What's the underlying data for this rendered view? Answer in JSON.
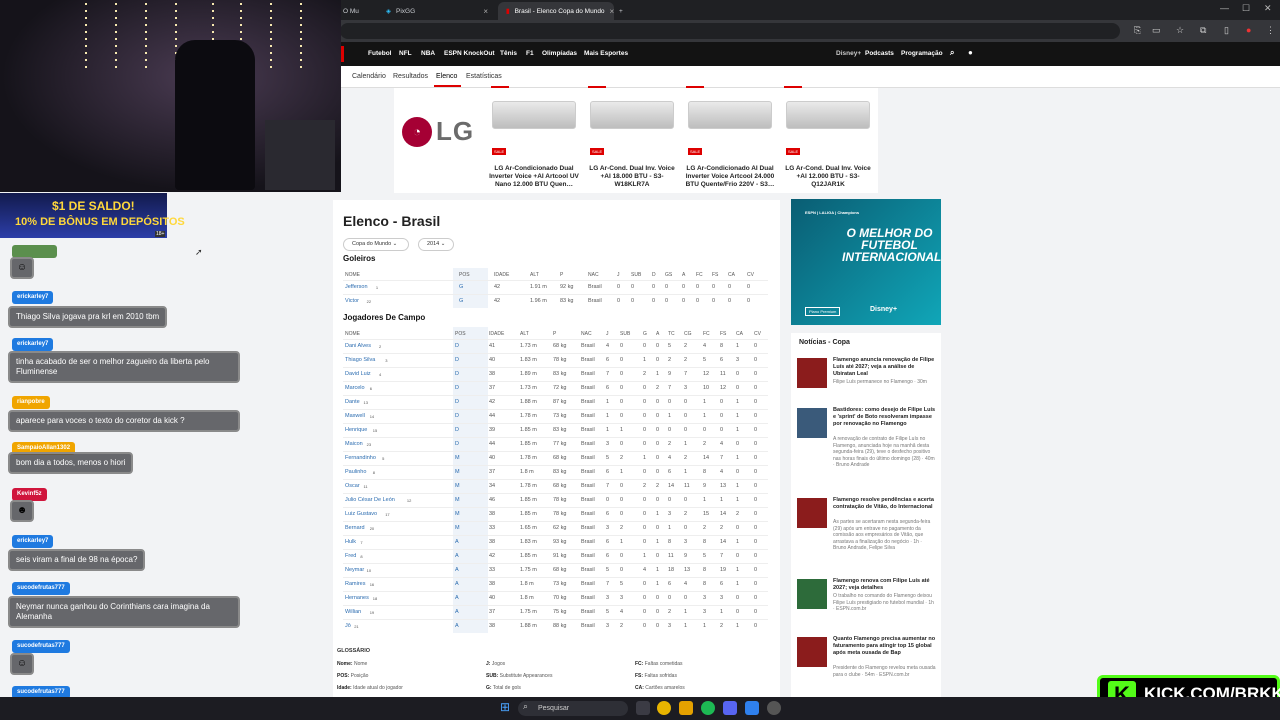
{
  "browser": {
    "tabs": [
      {
        "label": "O Mu",
        "active": false
      },
      {
        "label": "PixGG",
        "active": false
      },
      {
        "label": "Brasil - Elenco Copa do Mundo",
        "active": true
      }
    ],
    "new_tab": "+",
    "window_controls": [
      "—",
      "☐",
      "✕"
    ]
  },
  "espn": {
    "nav": [
      "Futebol",
      "NFL",
      "NBA",
      "ESPN KnockOut",
      "Tênis",
      "F1",
      "Olimpíadas",
      "Mais Esportes"
    ],
    "nav_right": [
      "Podcasts",
      "Programação"
    ],
    "subnav": [
      "Calendário",
      "Resultados",
      "Elenco",
      "Estatísticas"
    ],
    "subnav_active": "Elenco"
  },
  "ad": {
    "brand": "LG",
    "products": [
      "LG Ar-Condicionado Dual Inverter Voice +AI Artcool UV Nano 12.000 BTU Quen…",
      "LG Ar-Cond. Dual Inv. Voice +AI 18.000 BTU - S3-W18KLR7A",
      "LG Ar-Condicionado AI Dual Inverter Voice Artcool 24.000 BTU Quente/Frio 220V - S3…",
      "LG Ar-Cond. Dual Inv. Voice +AI 12.000 BTU - S3-Q12JAR1K"
    ],
    "sale_label": "SALE"
  },
  "page": {
    "title": "Elenco - Brasil",
    "filter_competition": "Copa do Mundo",
    "filter_year": "2014",
    "goalkeepers_title": "Goleiros",
    "field_title": "Jogadores De Campo",
    "gk_headers": [
      "NOME",
      "POS",
      "IDADE",
      "ALT",
      "P",
      "NAC",
      "J",
      "SUB",
      "D",
      "GS",
      "A",
      "FC",
      "FS",
      "CA",
      "CV"
    ],
    "field_headers": [
      "NOME",
      "POS",
      "IDADE",
      "ALT",
      "P",
      "NAC",
      "J",
      "SUB",
      "G",
      "A",
      "TC",
      "CG",
      "FC",
      "FS",
      "CA",
      "CV"
    ],
    "goalkeepers": [
      [
        "Jefferson",
        "1",
        "G",
        "42",
        "1.91 m",
        "92 kg",
        "Brasil",
        "0",
        "0",
        "0",
        "0",
        "0",
        "0",
        "0",
        "0",
        "0"
      ],
      [
        "Victor",
        "22",
        "G",
        "42",
        "1.96 m",
        "83 kg",
        "Brasil",
        "0",
        "0",
        "0",
        "0",
        "0",
        "0",
        "0",
        "0",
        "0"
      ]
    ],
    "players": [
      [
        "Dani Alves",
        "2",
        "D",
        "41",
        "1.73 m",
        "68 kg",
        "Brasil",
        "4",
        "0",
        "0",
        "0",
        "5",
        "2",
        "4",
        "8",
        "1",
        "0"
      ],
      [
        "Thiago Silva",
        "3",
        "D",
        "40",
        "1.83 m",
        "78 kg",
        "Brasil",
        "6",
        "0",
        "1",
        "0",
        "2",
        "2",
        "5",
        "6",
        "3",
        "0"
      ],
      [
        "David Luiz",
        "4",
        "D",
        "38",
        "1.89 m",
        "83 kg",
        "Brasil",
        "7",
        "0",
        "2",
        "1",
        "9",
        "7",
        "12",
        "11",
        "0",
        "0"
      ],
      [
        "Marcelo",
        "6",
        "D",
        "37",
        "1.73 m",
        "72 kg",
        "Brasil",
        "6",
        "0",
        "0",
        "2",
        "7",
        "3",
        "10",
        "12",
        "0",
        "0"
      ],
      [
        "Dante",
        "13",
        "D",
        "42",
        "1.88 m",
        "87 kg",
        "Brasil",
        "1",
        "0",
        "0",
        "0",
        "0",
        "0",
        "1",
        "0",
        "1",
        "0"
      ],
      [
        "Maxwell",
        "14",
        "D",
        "44",
        "1.78 m",
        "73 kg",
        "Brasil",
        "1",
        "0",
        "0",
        "0",
        "1",
        "0",
        "1",
        "0",
        "1",
        "0"
      ],
      [
        "Henrique",
        "15",
        "D",
        "39",
        "1.85 m",
        "83 kg",
        "Brasil",
        "1",
        "1",
        "0",
        "0",
        "0",
        "0",
        "0",
        "0",
        "1",
        "0"
      ],
      [
        "Maicon",
        "23",
        "D",
        "44",
        "1.85 m",
        "77 kg",
        "Brasil",
        "3",
        "0",
        "0",
        "0",
        "2",
        "1",
        "2",
        "4",
        "0",
        "0"
      ],
      [
        "Fernandinho",
        "5",
        "M",
        "40",
        "1.78 m",
        "68 kg",
        "Brasil",
        "5",
        "2",
        "1",
        "0",
        "4",
        "2",
        "14",
        "7",
        "1",
        "0"
      ],
      [
        "Paulinho",
        "8",
        "M",
        "37",
        "1.8 m",
        "83 kg",
        "Brasil",
        "6",
        "1",
        "0",
        "0",
        "6",
        "1",
        "8",
        "4",
        "0",
        "0"
      ],
      [
        "Oscar",
        "11",
        "M",
        "34",
        "1.78 m",
        "68 kg",
        "Brasil",
        "7",
        "0",
        "2",
        "2",
        "14",
        "11",
        "9",
        "13",
        "1",
        "0"
      ],
      [
        "Julio César De León",
        "12",
        "M",
        "46",
        "1.85 m",
        "78 kg",
        "Brasil",
        "0",
        "0",
        "0",
        "0",
        "0",
        "0",
        "1",
        "1",
        "1",
        "0"
      ],
      [
        "Luiz Gustavo",
        "17",
        "M",
        "38",
        "1.85 m",
        "78 kg",
        "Brasil",
        "6",
        "0",
        "0",
        "1",
        "3",
        "2",
        "15",
        "14",
        "2",
        "0"
      ],
      [
        "Bernard",
        "20",
        "M",
        "33",
        "1.65 m",
        "62 kg",
        "Brasil",
        "3",
        "2",
        "0",
        "0",
        "1",
        "0",
        "2",
        "2",
        "0",
        "0"
      ],
      [
        "Hulk",
        "7",
        "A",
        "38",
        "1.83 m",
        "93 kg",
        "Brasil",
        "6",
        "1",
        "0",
        "1",
        "8",
        "3",
        "8",
        "14",
        "1",
        "0"
      ],
      [
        "Fred",
        "8",
        "A",
        "42",
        "1.85 m",
        "91 kg",
        "Brasil",
        "6",
        "0",
        "1",
        "0",
        "11",
        "9",
        "5",
        "7",
        "0",
        "0"
      ],
      [
        "Neymar",
        "10",
        "A",
        "33",
        "1.75 m",
        "68 kg",
        "Brasil",
        "5",
        "0",
        "4",
        "1",
        "18",
        "13",
        "8",
        "19",
        "1",
        "0"
      ],
      [
        "Ramires",
        "16",
        "A",
        "38",
        "1.8 m",
        "73 kg",
        "Brasil",
        "7",
        "5",
        "0",
        "1",
        "6",
        "4",
        "8",
        "6",
        "1",
        "0"
      ],
      [
        "Hernanes",
        "18",
        "A",
        "40",
        "1.8 m",
        "70 kg",
        "Brasil",
        "3",
        "3",
        "0",
        "0",
        "0",
        "0",
        "3",
        "3",
        "0",
        "0"
      ],
      [
        "Willian",
        "19",
        "A",
        "37",
        "1.75 m",
        "75 kg",
        "Brasil",
        "5",
        "4",
        "0",
        "0",
        "2",
        "1",
        "3",
        "1",
        "0",
        "0"
      ],
      [
        "Jô",
        "21",
        "A",
        "38",
        "1.88 m",
        "88 kg",
        "Brasil",
        "3",
        "2",
        "0",
        "0",
        "3",
        "1",
        "1",
        "2",
        "1",
        "0"
      ]
    ],
    "glossary_title": "GLOSSÁRIO",
    "glossary": [
      [
        "Nome:",
        "Nome"
      ],
      [
        "POS:",
        "Posição"
      ],
      [
        "Idade:",
        "Idade atual do jogador"
      ],
      [
        "J:",
        "Jogos"
      ],
      [
        "SUB:",
        "Substitute Appearances"
      ],
      [
        "G:",
        "Total de gols"
      ],
      [
        "FC:",
        "Faltas cometidas"
      ],
      [
        "FS:",
        "Faltas sofridas"
      ],
      [
        "CA:",
        "Cartões amarelos"
      ]
    ]
  },
  "sidebar": {
    "promo_top": "ESPN | LALIGA | Champions",
    "promo_text": "O MELHOR DO FUTEBOL INTERNACIONAL",
    "promo_plan": "Plano Premium",
    "promo_brand": "Disney+",
    "news_title": "Notícias - Copa",
    "news": [
      {
        "h": "Flamengo anuncia renovação de Filipe Luís até 2027; veja a análise de Ubiratan Leal",
        "s": "Filipe Luís permanece no Flamengo · 30m"
      },
      {
        "h": "Bastidores: como desejo de Filipe Luís e 'sprint' de Boto resolveram impasse por renovação no Flamengo",
        "s": "A renovação de contrato de Filipe Luís no Flamengo, anunciada hoje na manhã desta segunda-feira (29), teve o desfecho positivo nas horas finais do último domingo (28) · 40m · Bruno Andrade"
      },
      {
        "h": "Flamengo resolve pendências e acerta contratação de Vitão, do Internacional",
        "s": "As partes se acertaram nesta segunda-feira (29) após um entrave no pagamento da comissão aos empresários de Vitão, que arrastava a finalização do negócio · 1h · Bruno Andrade, Felipe Silva"
      },
      {
        "h": "Flamengo renova com Filipe Luís até 2027; veja detalhes",
        "s": "O trabalho no comando do Flamengo deixou Filipe Luís prestigiado no futebol mundial · 1h · ESPN.com.br"
      },
      {
        "h": "Quanto Flamengo precisa aumentar no faturamento para atingir top 15 global após meta ousada de Bap",
        "s": "Presidente do Flamengo revelou meta ousada para o clube · 54m · ESPN.com.br"
      }
    ]
  },
  "stream": {
    "promo_line1": "$1 DE SALDO!",
    "promo_line2": "10% DE BÔNUS EM DEPÓSITOS",
    "promo_age": "18+",
    "chat": [
      {
        "user": "erickarley7",
        "color": "#1f7ae0",
        "msg": "Thiago Silva jogava pra krl em 2010 tbm"
      },
      {
        "user": "erickarley7",
        "color": "#1f7ae0",
        "msg": "tinha acabado de ser o melhor zagueiro da liberta pelo Fluminense"
      },
      {
        "user": "rianpobre",
        "color": "#f0a500",
        "msg": "aparece para voces o texto do coretor da kick ?"
      },
      {
        "user": "SampaioAllan1302",
        "color": "#f0a500",
        "msg": "bom dia a todos, menos o hiori"
      },
      {
        "user": "Kevinf5z",
        "color": "#d0153c",
        "msg": ""
      },
      {
        "user": "erickarley7",
        "color": "#1f7ae0",
        "msg": "seis viram a final de 98 na época?"
      },
      {
        "user": "sucodefrutas777",
        "color": "#1f7ae0",
        "msg": "Neymar nunca ganhou do Corinthians cara imagina da Alemanha"
      },
      {
        "user": "sucodefrutas777",
        "color": "#1f7ae0",
        "msg": ""
      },
      {
        "user": "sucodefrutas777",
        "color": "#1f7ae0",
        "msg": ""
      }
    ],
    "kick_text": "KICK.COM/BRKK"
  },
  "taskbar": {
    "search_placeholder": "Pesquisar"
  }
}
